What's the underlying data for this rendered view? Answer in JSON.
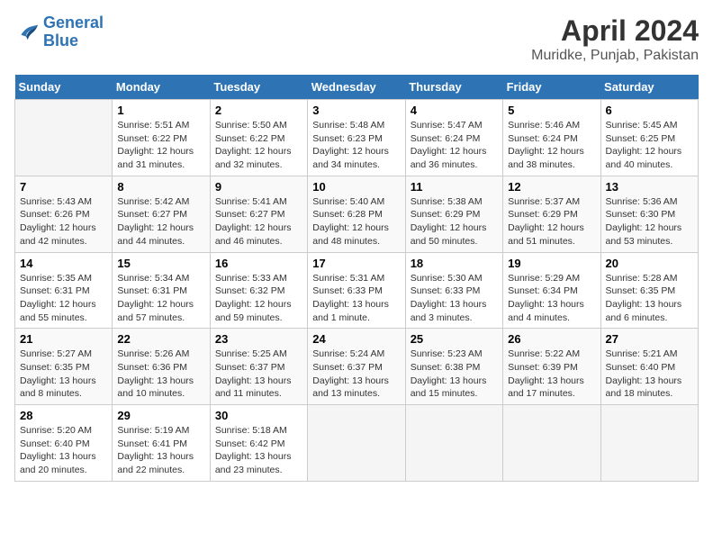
{
  "logo": {
    "line1": "General",
    "line2": "Blue"
  },
  "title": "April 2024",
  "subtitle": "Muridke, Punjab, Pakistan",
  "days_header": [
    "Sunday",
    "Monday",
    "Tuesday",
    "Wednesday",
    "Thursday",
    "Friday",
    "Saturday"
  ],
  "weeks": [
    [
      {
        "day": "",
        "detail": ""
      },
      {
        "day": "1",
        "detail": "Sunrise: 5:51 AM\nSunset: 6:22 PM\nDaylight: 12 hours\nand 31 minutes."
      },
      {
        "day": "2",
        "detail": "Sunrise: 5:50 AM\nSunset: 6:22 PM\nDaylight: 12 hours\nand 32 minutes."
      },
      {
        "day": "3",
        "detail": "Sunrise: 5:48 AM\nSunset: 6:23 PM\nDaylight: 12 hours\nand 34 minutes."
      },
      {
        "day": "4",
        "detail": "Sunrise: 5:47 AM\nSunset: 6:24 PM\nDaylight: 12 hours\nand 36 minutes."
      },
      {
        "day": "5",
        "detail": "Sunrise: 5:46 AM\nSunset: 6:24 PM\nDaylight: 12 hours\nand 38 minutes."
      },
      {
        "day": "6",
        "detail": "Sunrise: 5:45 AM\nSunset: 6:25 PM\nDaylight: 12 hours\nand 40 minutes."
      }
    ],
    [
      {
        "day": "7",
        "detail": "Sunrise: 5:43 AM\nSunset: 6:26 PM\nDaylight: 12 hours\nand 42 minutes."
      },
      {
        "day": "8",
        "detail": "Sunrise: 5:42 AM\nSunset: 6:27 PM\nDaylight: 12 hours\nand 44 minutes."
      },
      {
        "day": "9",
        "detail": "Sunrise: 5:41 AM\nSunset: 6:27 PM\nDaylight: 12 hours\nand 46 minutes."
      },
      {
        "day": "10",
        "detail": "Sunrise: 5:40 AM\nSunset: 6:28 PM\nDaylight: 12 hours\nand 48 minutes."
      },
      {
        "day": "11",
        "detail": "Sunrise: 5:38 AM\nSunset: 6:29 PM\nDaylight: 12 hours\nand 50 minutes."
      },
      {
        "day": "12",
        "detail": "Sunrise: 5:37 AM\nSunset: 6:29 PM\nDaylight: 12 hours\nand 51 minutes."
      },
      {
        "day": "13",
        "detail": "Sunrise: 5:36 AM\nSunset: 6:30 PM\nDaylight: 12 hours\nand 53 minutes."
      }
    ],
    [
      {
        "day": "14",
        "detail": "Sunrise: 5:35 AM\nSunset: 6:31 PM\nDaylight: 12 hours\nand 55 minutes."
      },
      {
        "day": "15",
        "detail": "Sunrise: 5:34 AM\nSunset: 6:31 PM\nDaylight: 12 hours\nand 57 minutes."
      },
      {
        "day": "16",
        "detail": "Sunrise: 5:33 AM\nSunset: 6:32 PM\nDaylight: 12 hours\nand 59 minutes."
      },
      {
        "day": "17",
        "detail": "Sunrise: 5:31 AM\nSunset: 6:33 PM\nDaylight: 13 hours\nand 1 minute."
      },
      {
        "day": "18",
        "detail": "Sunrise: 5:30 AM\nSunset: 6:33 PM\nDaylight: 13 hours\nand 3 minutes."
      },
      {
        "day": "19",
        "detail": "Sunrise: 5:29 AM\nSunset: 6:34 PM\nDaylight: 13 hours\nand 4 minutes."
      },
      {
        "day": "20",
        "detail": "Sunrise: 5:28 AM\nSunset: 6:35 PM\nDaylight: 13 hours\nand 6 minutes."
      }
    ],
    [
      {
        "day": "21",
        "detail": "Sunrise: 5:27 AM\nSunset: 6:35 PM\nDaylight: 13 hours\nand 8 minutes."
      },
      {
        "day": "22",
        "detail": "Sunrise: 5:26 AM\nSunset: 6:36 PM\nDaylight: 13 hours\nand 10 minutes."
      },
      {
        "day": "23",
        "detail": "Sunrise: 5:25 AM\nSunset: 6:37 PM\nDaylight: 13 hours\nand 11 minutes."
      },
      {
        "day": "24",
        "detail": "Sunrise: 5:24 AM\nSunset: 6:37 PM\nDaylight: 13 hours\nand 13 minutes."
      },
      {
        "day": "25",
        "detail": "Sunrise: 5:23 AM\nSunset: 6:38 PM\nDaylight: 13 hours\nand 15 minutes."
      },
      {
        "day": "26",
        "detail": "Sunrise: 5:22 AM\nSunset: 6:39 PM\nDaylight: 13 hours\nand 17 minutes."
      },
      {
        "day": "27",
        "detail": "Sunrise: 5:21 AM\nSunset: 6:40 PM\nDaylight: 13 hours\nand 18 minutes."
      }
    ],
    [
      {
        "day": "28",
        "detail": "Sunrise: 5:20 AM\nSunset: 6:40 PM\nDaylight: 13 hours\nand 20 minutes."
      },
      {
        "day": "29",
        "detail": "Sunrise: 5:19 AM\nSunset: 6:41 PM\nDaylight: 13 hours\nand 22 minutes."
      },
      {
        "day": "30",
        "detail": "Sunrise: 5:18 AM\nSunset: 6:42 PM\nDaylight: 13 hours\nand 23 minutes."
      },
      {
        "day": "",
        "detail": ""
      },
      {
        "day": "",
        "detail": ""
      },
      {
        "day": "",
        "detail": ""
      },
      {
        "day": "",
        "detail": ""
      }
    ]
  ]
}
